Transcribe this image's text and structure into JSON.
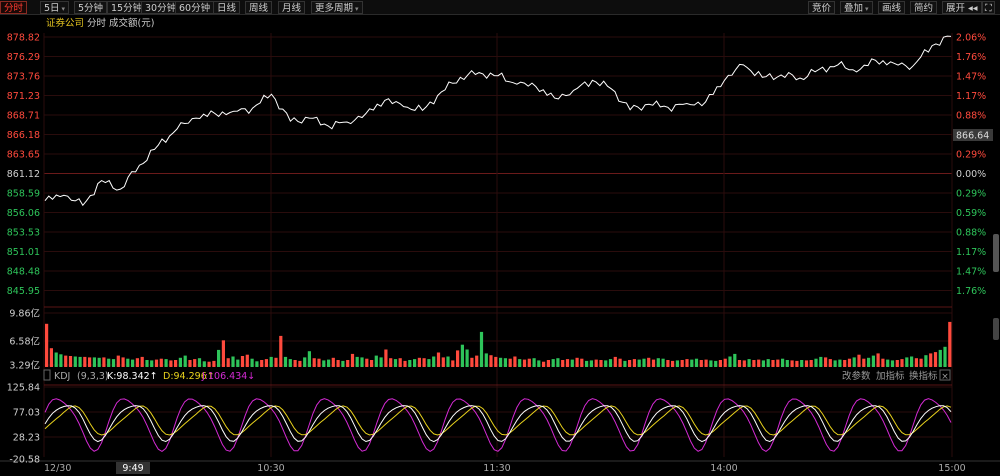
{
  "toolbar": {
    "left": [
      {
        "label": "分时",
        "active": true,
        "caret": false
      },
      {
        "label": "5日",
        "active": false,
        "caret": true
      },
      {
        "label": "5分钟",
        "active": false,
        "caret": false
      },
      {
        "label": "15分钟",
        "active": false,
        "caret": false
      },
      {
        "label": "30分钟",
        "active": false,
        "caret": false
      },
      {
        "label": "60分钟",
        "active": false,
        "caret": false
      },
      {
        "label": "日线",
        "active": false,
        "caret": false
      },
      {
        "label": "周线",
        "active": false,
        "caret": false
      },
      {
        "label": "月线",
        "active": false,
        "caret": false
      },
      {
        "label": "更多周期",
        "active": false,
        "caret": true
      }
    ],
    "right": [
      {
        "label": "竞价",
        "caret": false
      },
      {
        "label": "叠加",
        "caret": true
      },
      {
        "label": "画线",
        "caret": false
      },
      {
        "label": "简约",
        "caret": false
      },
      {
        "label": "展开 ◂◂",
        "caret": false
      }
    ],
    "fullscreen_icon": "expand-icon"
  },
  "header": {
    "name": "证券公司",
    "period": "分时",
    "volume_label": "成交额(元)"
  },
  "price_axis": {
    "left_labels": [
      "878.82",
      "876.29",
      "873.76",
      "871.23",
      "868.71",
      "866.18",
      "863.65",
      "861.12",
      "858.59",
      "856.06",
      "853.53",
      "851.01",
      "848.48",
      "845.95"
    ],
    "right_labels": [
      "2.06%",
      "1.76%",
      "1.47%",
      "1.17%",
      "0.88%",
      "0.59%",
      "0.29%",
      "0.00%",
      "0.29%",
      "0.59%",
      "0.88%",
      "1.17%",
      "1.47%",
      "1.76%"
    ],
    "current_value": "866.64",
    "prev_close": 861.12,
    "max": 878.82,
    "min": 843.42
  },
  "volume_axis": {
    "labels": [
      "9.86亿",
      "6.58亿",
      "3.29亿"
    ],
    "max": 9.86
  },
  "kdj": {
    "title": "KDJ",
    "params": "(9,3,3)",
    "k_text": "K:98.342↑",
    "d_text": "D:94.296↑",
    "j_text": "J:106.434↓",
    "buttons": [
      "改参数",
      "加指标",
      "换指标"
    ],
    "close_icon": "close-icon",
    "axis_labels": [
      "125.84",
      "77.03",
      "28.23",
      "-20.58"
    ],
    "max": 125.84,
    "min": -20.58
  },
  "time_axis": {
    "labels": [
      "12/30",
      "9:49",
      "10:30",
      "11:30",
      "14:00",
      "15:00"
    ],
    "highlight": "9:49"
  },
  "colors": {
    "up": "#ff4a3d",
    "down": "#2ec45a",
    "price_line": "#ffffff",
    "k_line": "#ffffff",
    "d_line": "#e8d21d",
    "j_line": "#d42ad4",
    "grid": "#2a0a0a",
    "label_gray": "#cfcfcf"
  },
  "chart_data": {
    "type": "line",
    "title": "证券公司",
    "price_series": {
      "name": "证券公司",
      "time": [
        "9:30",
        "9:35",
        "9:40",
        "9:45",
        "9:50",
        "9:55",
        "10:00",
        "10:05",
        "10:10",
        "10:15",
        "10:20",
        "10:25",
        "10:30",
        "10:35",
        "10:40",
        "10:45",
        "10:50",
        "10:55",
        "11:00",
        "11:05",
        "11:10",
        "11:15",
        "11:20",
        "11:25",
        "11:30",
        "13:05",
        "13:10",
        "13:15",
        "13:20",
        "13:25",
        "13:30",
        "13:35",
        "13:40",
        "13:45",
        "13:50",
        "13:55",
        "14:00",
        "14:05",
        "14:10",
        "14:15",
        "14:20",
        "14:25",
        "14:30",
        "14:35",
        "14:40",
        "14:45",
        "14:50",
        "14:55",
        "15:00"
      ],
      "values": [
        857.6,
        858.3,
        857.0,
        860.2,
        859.1,
        862.2,
        864.8,
        866.9,
        868.3,
        868.9,
        869.2,
        869.6,
        871.4,
        867.9,
        868.3,
        867.3,
        867.8,
        868.9,
        870.6,
        869.8,
        869.3,
        871.7,
        873.6,
        874.2,
        873.8,
        872.7,
        872.4,
        870.9,
        871.9,
        873.2,
        872.1,
        869.4,
        870.1,
        869.7,
        870.2,
        870.4,
        873.2,
        875.2,
        873.6,
        873.9,
        873.5,
        874.6,
        875.2,
        874.3,
        875.8,
        875.4,
        875.1,
        877.7,
        878.9
      ]
    },
    "volume_series": {
      "name": "成交额(元)",
      "unit": "亿",
      "values_yi": [
        9.86,
        4.3,
        3.3,
        2.9,
        2.6,
        2.5,
        2.4,
        2.3,
        2.3,
        2.2,
        2.2,
        2.1,
        2.2,
        1.9,
        1.8,
        2.6,
        2.2,
        1.9,
        1.7,
        2.0,
        2.3,
        1.6,
        1.5,
        1.7,
        1.9,
        1.8,
        1.5,
        1.6,
        2.1,
        2.6,
        1.6,
        1.8,
        2.0,
        1.3,
        1.2,
        1.4,
        3.9,
        6.1,
        2.0,
        2.4,
        1.7,
        2.5,
        2.8,
        1.9,
        1.3,
        1.6,
        1.8,
        2.3,
        2.1,
        7.1,
        2.3,
        1.8,
        1.6,
        1.4,
        2.2,
        3.6,
        2.0,
        1.9,
        1.5,
        1.7,
        2.1,
        1.6,
        1.4,
        1.6,
        3.0,
        2.3,
        2.2,
        1.9,
        1.6,
        2.6,
        2.2,
        4.0,
        2.0,
        1.8,
        2.0,
        1.4,
        1.6,
        1.8,
        2.1,
        2.0,
        1.8,
        2.4,
        3.3,
        2.2,
        2.4,
        1.5,
        3.8,
        5.1,
        4.0,
        2.1,
        2.6,
        8.0,
        3.1,
        2.7,
        2.3,
        2.1,
        2.0,
        1.9,
        2.4,
        1.8,
        1.7,
        1.9,
        2.0,
        1.5,
        1.2,
        1.6,
        1.8,
        2.0,
        1.6,
        1.8,
        1.7,
        2.1,
        1.9,
        1.4,
        1.5,
        1.7,
        1.6,
        1.5,
        1.8,
        2.3,
        1.9,
        1.4,
        1.6,
        1.8,
        1.7,
        1.9,
        2.1,
        1.7,
        2.0,
        1.9,
        1.6,
        1.4,
        1.5,
        1.6,
        1.8,
        1.7,
        1.9,
        1.6,
        1.7,
        1.5,
        1.4,
        1.6,
        1.9,
        2.4,
        3.0,
        1.6,
        1.5,
        1.8,
        1.6,
        1.7,
        1.5,
        1.8,
        1.6,
        1.7,
        1.9,
        1.6,
        1.5,
        1.4,
        1.6,
        1.5,
        1.6,
        1.9,
        2.3,
        2.2,
        1.8,
        1.5,
        1.7,
        1.6,
        1.9,
        2.2,
        2.8,
        1.9,
        2.1,
        2.6,
        3.1,
        1.9,
        1.7,
        1.5,
        1.6,
        1.8,
        2.2,
        2.4,
        2.0,
        1.9,
        2.7,
        3.1,
        3.4,
        3.9,
        4.6,
        10.3
      ]
    },
    "kdj_series": [
      {
        "name": "K",
        "last": 98.342
      },
      {
        "name": "D",
        "last": 94.296
      },
      {
        "name": "J",
        "last": 106.434
      }
    ]
  }
}
